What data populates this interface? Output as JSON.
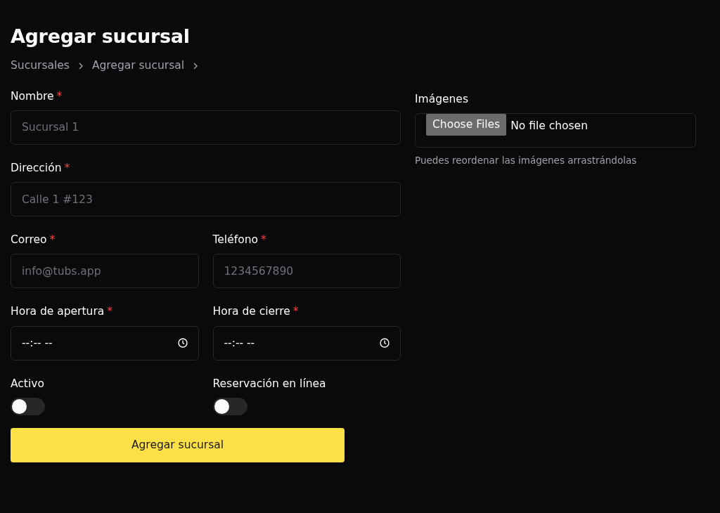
{
  "title": "Agregar sucursal",
  "breadcrumb": [
    {
      "label": "Sucursales"
    },
    {
      "label": "Agregar sucursal"
    }
  ],
  "rows": [
    [
      {
        "kind": "text",
        "label": "Nombre",
        "required_mark": "*",
        "placeholder": "Sucursal 1"
      }
    ],
    [
      {
        "kind": "text",
        "label": "Dirección",
        "required_mark": "*",
        "placeholder": "Calle 1 #123"
      }
    ],
    [
      {
        "kind": "text",
        "label": "Correo",
        "required_mark": "*",
        "placeholder": "info@tubs.app"
      },
      {
        "kind": "text",
        "label": "Teléfono",
        "required_mark": "*",
        "placeholder": "1234567890"
      }
    ],
    [
      {
        "kind": "time",
        "label": "Hora de apertura",
        "required_mark": "*",
        "value": "--:-- --"
      },
      {
        "kind": "time",
        "label": "Hora de cierre",
        "required_mark": "*",
        "value": "--:-- --"
      }
    ],
    [
      {
        "kind": "toggle",
        "label": "Activo",
        "on": false
      },
      {
        "kind": "toggle",
        "label": "Reservación en línea",
        "on": false
      }
    ]
  ],
  "submit": "Agregar sucursal",
  "images": {
    "label": "Imágenes",
    "button": "Choose Files",
    "status": "No file chosen",
    "help": "Puedes reordenar las imágenes arrastrándolas"
  }
}
